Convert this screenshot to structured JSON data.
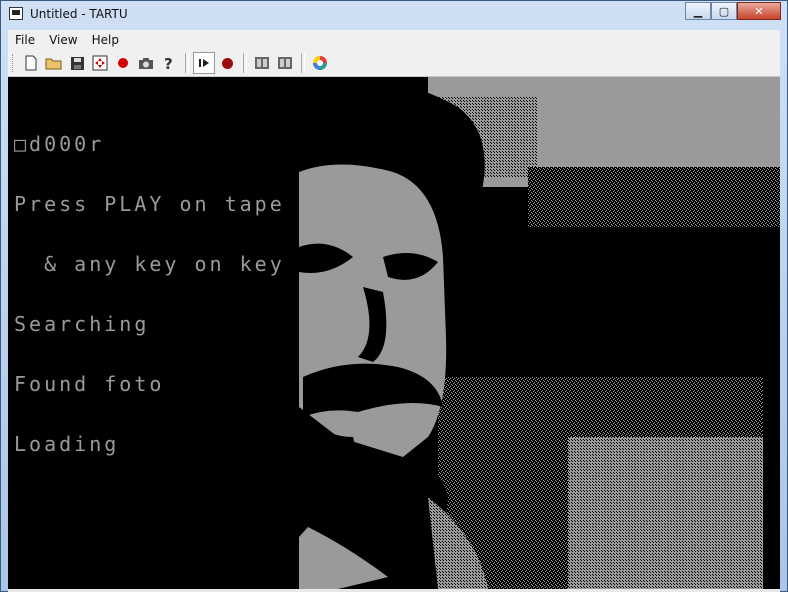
{
  "window": {
    "title": "Untitled - TARTU",
    "controls": {
      "minimize": "▁",
      "maximize": "▢",
      "close": "✕"
    }
  },
  "menu": {
    "items": [
      "File",
      "View",
      "Help"
    ]
  },
  "toolbar": {
    "buttons": [
      {
        "name": "new-file-icon",
        "glyph": "🗋"
      },
      {
        "name": "open-folder-icon",
        "glyph": "📂"
      },
      {
        "name": "save-icon",
        "glyph": "💾"
      },
      {
        "name": "fullscreen-icon",
        "glyph": "✜"
      },
      {
        "name": "record-icon",
        "glyph": "●"
      },
      {
        "name": "camera-icon",
        "glyph": "📷"
      },
      {
        "name": "help-icon",
        "glyph": "?"
      },
      {
        "name": "play-icon",
        "glyph": "⏵"
      },
      {
        "name": "tape-record-icon",
        "glyph": "●"
      },
      {
        "name": "tape-load-icon",
        "glyph": "▤"
      },
      {
        "name": "tape-save-icon",
        "glyph": "▤"
      },
      {
        "name": "palette-icon",
        "glyph": "◉"
      }
    ]
  },
  "console": {
    "lines": [
      "□d000r",
      "Press PLAY on tape",
      "  & any key on key",
      "Searching",
      "Found foto",
      "Loading"
    ]
  },
  "colors": {
    "screen_bg": "#000000",
    "screen_fg": "#9a9a9a"
  }
}
